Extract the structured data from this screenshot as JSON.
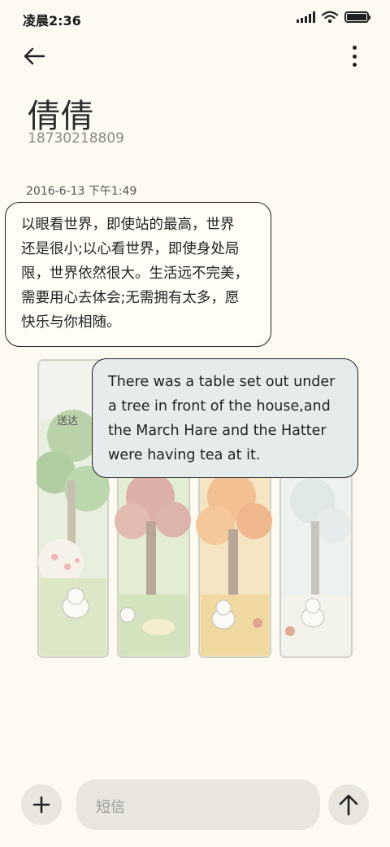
{
  "status_bar": {
    "time": "凌晨2:36",
    "icons": [
      "signal-icon",
      "wifi-icon",
      "battery-icon"
    ]
  },
  "header": {
    "back_icon": "arrow-left-icon",
    "more_icon": "more-vertical-icon"
  },
  "contact": {
    "name": "倩倩",
    "number": "18730218809"
  },
  "conversation": {
    "timestamp": "2016-6-13 下午1:49",
    "incoming_message": {
      "lines": [
        "以眼看世界，即使站的最高，世界",
        "还是很小;以心看世界，即使身处局",
        "限，世界依然很大。生活远不完美，",
        "需要用心去体会;无需拥有太多，愿",
        "快乐与你相随。"
      ]
    },
    "outgoing_message": {
      "lines": [
        "There was a table set out under",
        "a tree in front of the house,and",
        "the March Hare and the Hatter",
        "were having tea at it."
      ]
    },
    "sticker_status": "送达"
  },
  "composer": {
    "add_icon": "plus-icon",
    "placeholder": "短信",
    "send_icon": "arrow-up-icon"
  },
  "colors": {
    "background": "#fcfaf1",
    "incoming_bubble": "#fffdf5",
    "outgoing_bubble": "#e5eceb",
    "composer_controls": "#e8e6df"
  }
}
